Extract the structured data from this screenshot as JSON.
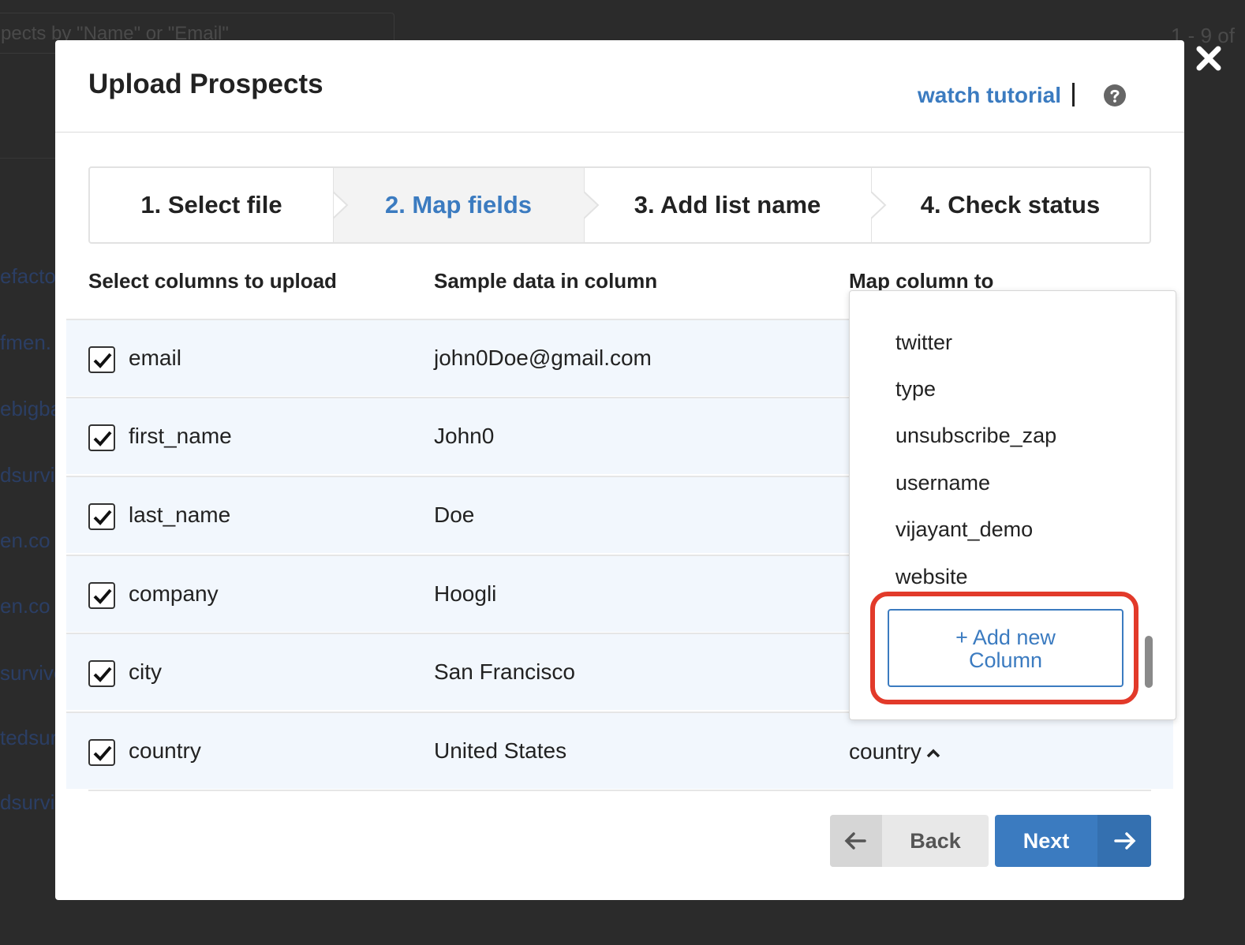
{
  "background": {
    "search_placeholder": "pects by \"Name\" or \"Email\"",
    "pager_text": "1 - 9 of",
    "row_links": [
      "efacto",
      "fmen.",
      "ebigba",
      "dsurvi",
      "en.co",
      "en.co",
      "survive",
      "tedsur",
      "dsurvi"
    ]
  },
  "modal": {
    "title": "Upload Prospects",
    "watch_tutorial": "watch tutorial",
    "help_icon": "question-circle",
    "close_icon": "close-x"
  },
  "steps": [
    {
      "label": "1. Select file",
      "active": false
    },
    {
      "label": "2. Map fields",
      "active": true
    },
    {
      "label": "3. Add list name",
      "active": false
    },
    {
      "label": "4. Check status",
      "active": false
    }
  ],
  "table": {
    "headers": {
      "select": "Select columns to upload",
      "sample": "Sample data in column",
      "map": "Map column to"
    },
    "rows": [
      {
        "column": "email",
        "sample": "john0Doe@gmail.com",
        "checked": true,
        "map": ""
      },
      {
        "column": "first_name",
        "sample": "John0",
        "checked": true,
        "map": ""
      },
      {
        "column": "last_name",
        "sample": "Doe",
        "checked": true,
        "map": ""
      },
      {
        "column": "company",
        "sample": "Hoogli",
        "checked": true,
        "map": ""
      },
      {
        "column": "city",
        "sample": "San Francisco",
        "checked": true,
        "map": ""
      },
      {
        "column": "country",
        "sample": "United States",
        "checked": true,
        "map": "country"
      }
    ]
  },
  "dropdown": {
    "items": [
      "twitter",
      "type",
      "unsubscribe_zap",
      "username",
      "vijayant_demo",
      "website"
    ],
    "add_button_line1": "+ Add new",
    "add_button_line2": "Column"
  },
  "footer": {
    "back_label": "Back",
    "next_label": "Next"
  },
  "colors": {
    "accent": "#3b7bc0",
    "highlight": "#e23a2a",
    "row_bg": "#f2f7fd"
  }
}
